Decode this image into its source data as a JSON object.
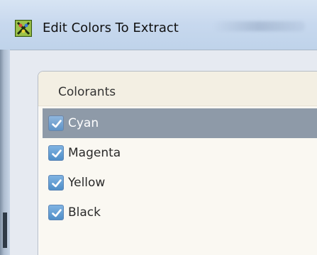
{
  "window": {
    "title": "Edit Colors To Extract"
  },
  "panel": {
    "header": "Colorants",
    "items": [
      {
        "label": "Cyan",
        "checked": true,
        "selected": true
      },
      {
        "label": "Magenta",
        "checked": true,
        "selected": false
      },
      {
        "label": "Yellow",
        "checked": true,
        "selected": false
      },
      {
        "label": "Black",
        "checked": true,
        "selected": false
      }
    ]
  },
  "icons": {
    "app": "app-icon",
    "check": "checkmark-icon"
  },
  "colors": {
    "selection": "#8e9aa8",
    "checkbox": "#4f8ec7"
  }
}
